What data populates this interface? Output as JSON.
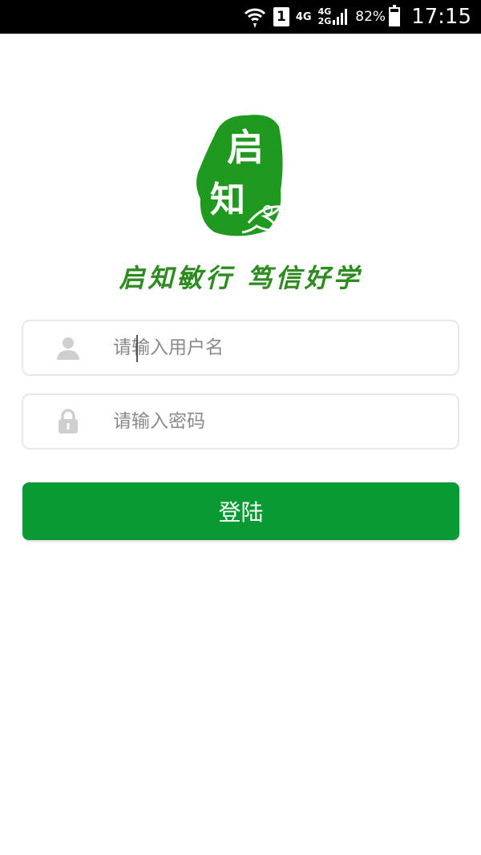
{
  "status_bar": {
    "sim_slot": "1",
    "network_primary": "4G",
    "network_secondary_top": "4G",
    "network_secondary_bottom": "2G",
    "battery_percent": "82%",
    "battery_level": 0.82,
    "time": "17:15",
    "icons": [
      "wifi-icon",
      "signal-icon",
      "battery-icon"
    ]
  },
  "logo": {
    "characters": [
      "启",
      "知"
    ],
    "color": "#1f9a1f"
  },
  "slogan": "启知敏行  笃信好学",
  "form": {
    "username": {
      "placeholder": "请输入用户名",
      "icon": "user-icon"
    },
    "password": {
      "placeholder": "请输入密码",
      "icon": "lock-icon"
    },
    "login_label": "登陆"
  },
  "colors": {
    "brand_green": "#0a9a33",
    "field_border": "#e8e8e8",
    "placeholder": "#8a8a8a"
  }
}
